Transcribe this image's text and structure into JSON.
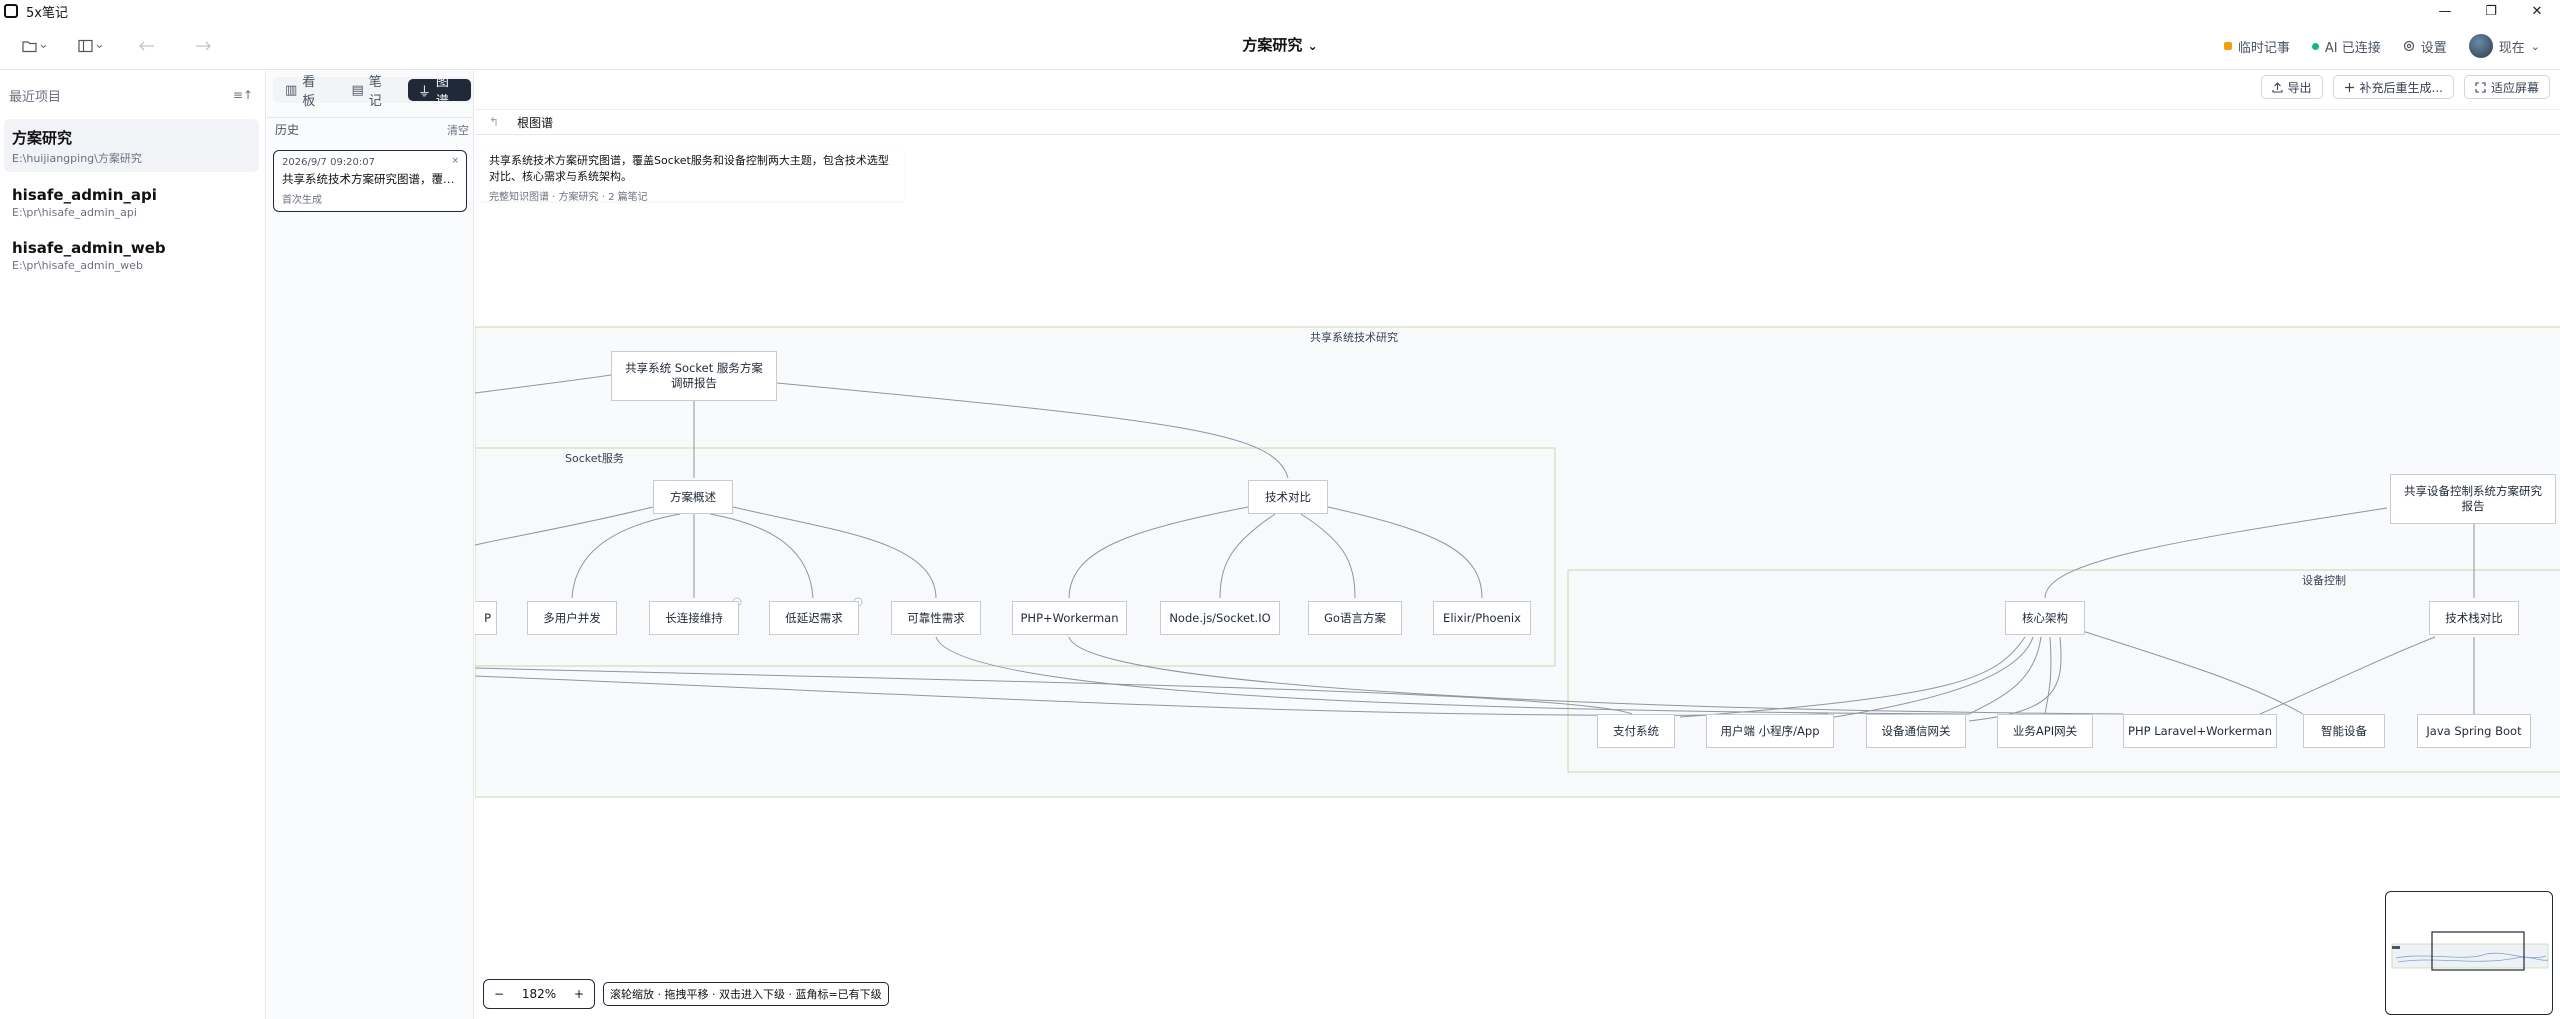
{
  "window": {
    "app_title": "5x笔记",
    "controls": [
      "—",
      "❐",
      "✕"
    ]
  },
  "toolbar": {
    "doc_title": "方案研究",
    "doc_title_caret": "⌄",
    "scratch_label": "临时记事",
    "ai_label": "AI 已连接",
    "settings_label": "设置",
    "user_name": "现在",
    "user_caret": "⌄"
  },
  "sidebar": {
    "heading": "最近项目",
    "sort_icon": "≡↑",
    "projects": [
      {
        "name": "方案研究",
        "path": "E:\\huijiangping\\方案研究"
      },
      {
        "name": "hisafe_admin_api",
        "path": "E:\\pr\\hisafe_admin_api"
      },
      {
        "name": "hisafe_admin_web",
        "path": "E:\\pr\\hisafe_admin_web"
      }
    ]
  },
  "view_tabs": [
    {
      "label": "看板",
      "icon": "▥"
    },
    {
      "label": "笔记",
      "icon": "▤"
    },
    {
      "label": "图谱",
      "icon": "⏚"
    }
  ],
  "history": {
    "heading": "历史",
    "clear_label": "清空",
    "entries": [
      {
        "time": "2026/9/7 09:20:07",
        "title": "共享系统技术方案研究图谱，覆盖...",
        "sub": "首次生成",
        "close": "×"
      }
    ]
  },
  "main_actions": {
    "export_label": "导出",
    "regen_label": "补充后重生成...",
    "fit_label": "适应屏幕"
  },
  "breadcrumb": {
    "back": "↰",
    "label": "根图谱"
  },
  "summary": {
    "text": "共享系统技术方案研究图谱，覆盖Socket服务和设备控制两大主题，包含技术选型对比、核心需求与系统架构。",
    "meta": "完整知识图谱 · 方案研究 · 2 篇笔记"
  },
  "graph": {
    "groups": {
      "outer": "共享系统技术研究",
      "socket": "Socket服务",
      "device": "设备控制"
    },
    "nodes": {
      "socket_report": "共享系统 Socket 服务方案调研报告",
      "overview": "方案概述",
      "tech_compare": "技术对比",
      "partial": "P",
      "multi_user": "多用户并发",
      "long_conn": "长连接维持",
      "low_latency": "低延迟需求",
      "scalability": "可靠性需求",
      "php_workerman": "PHP+Workerman",
      "nodejs": "Node.js/Socket.IO",
      "golang": "Go语言方案",
      "elixir": "Elixir/Phoenix",
      "device_report": "共享设备控制系统方案研究报告",
      "core_arch": "核心架构",
      "stack_compare": "技术栈对比",
      "payment": "支付系统",
      "user_client": "用户端 小程序/App",
      "device_gateway": "设备通信网关",
      "api_gateway": "业务API网关",
      "php_laravel": "PHP Laravel+Workerman",
      "smart_device": "智能设备",
      "java_spring": "Java Spring Boot"
    }
  },
  "zoom": {
    "minus": "−",
    "level": "182%",
    "plus": "+"
  },
  "hint": "滚轮缩放 · 拖拽平移 · 双击进入下级 · 蓝角标=已有下级"
}
